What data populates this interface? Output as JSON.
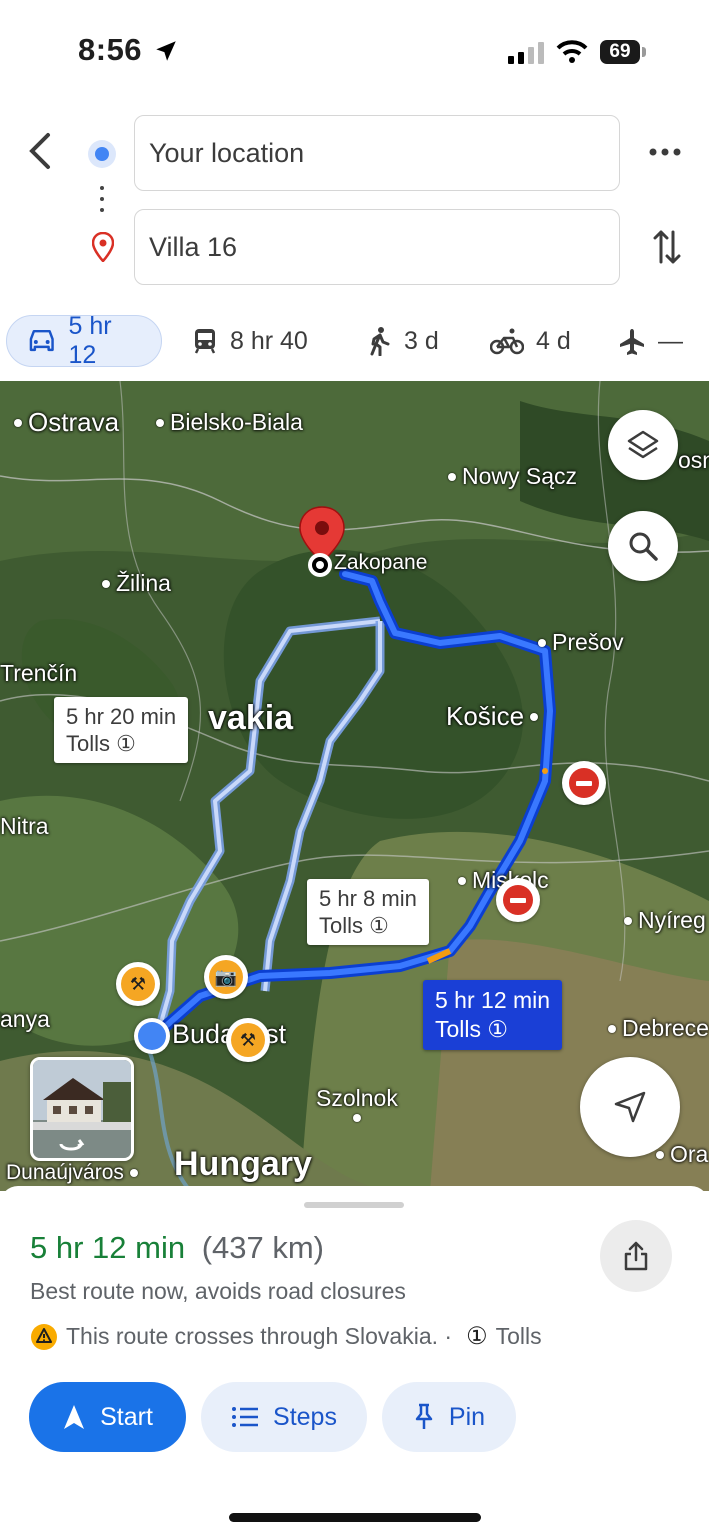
{
  "status": {
    "time": "8:56",
    "battery": "69"
  },
  "search": {
    "origin": "Your location",
    "destination": "Villa 16"
  },
  "modes": [
    {
      "icon": "car-icon",
      "label": "5 hr 12"
    },
    {
      "icon": "transit-icon",
      "label": "8 hr 40"
    },
    {
      "icon": "walk-icon",
      "label": "3 d"
    },
    {
      "icon": "bike-icon",
      "label": "4 d"
    },
    {
      "icon": "flight-icon",
      "label": "—"
    }
  ],
  "map": {
    "cities": {
      "ostrava": "Ostrava",
      "bielsko": "Bielsko-Biala",
      "nowy_sacz": "Nowy Sącz",
      "nosn": "osno",
      "zakopane": "Zakopane",
      "zilina": "Žilina",
      "presov": "Prešov",
      "trencin": "Trenčín",
      "kosice": "Košice",
      "nitra": "Nitra",
      "miskolc": "Miskolc",
      "nyireg": "Nyíreg",
      "anya": "anya",
      "budapest": "Budapest",
      "debrece": "Debrece",
      "szolnok": "Szolnok",
      "dunaujvaros": "Dunaújváros",
      "ora": "Ora",
      "hungary": "Hungary",
      "vakia": "vakia"
    },
    "routes": [
      {
        "time": "5 hr 20 min",
        "note": "Tolls"
      },
      {
        "time": "5 hr 8 min",
        "note": "Tolls"
      },
      {
        "time": "5 hr 12 min",
        "note": "Tolls"
      }
    ]
  },
  "summary": {
    "duration": "5 hr 12 min",
    "distance": "(437 km)",
    "description": "Best route now, avoids road closures",
    "warning": "This route crosses through Slovakia. ·",
    "tolls": "Tolls"
  },
  "actions": {
    "start": "Start",
    "steps": "Steps",
    "pin": "Pin"
  },
  "colors": {
    "accent": "#1a73e8",
    "duration_green": "#188038",
    "route_selected": "#1a3fd6"
  }
}
